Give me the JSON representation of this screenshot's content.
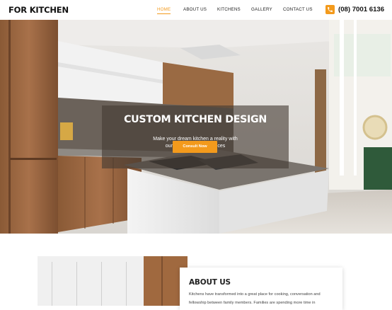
{
  "header": {
    "logo": "FOR KITCHEN",
    "nav": [
      {
        "label": "HOME",
        "active": true
      },
      {
        "label": "ABOUT US",
        "active": false
      },
      {
        "label": "KITCHENS",
        "active": false
      },
      {
        "label": "GALLERY",
        "active": false
      },
      {
        "label": "CONTACT US",
        "active": false
      }
    ],
    "phone_icon": "phone-icon",
    "phone": "(08) 7001 6136"
  },
  "hero": {
    "title": "CUSTOM KITCHEN DESIGN",
    "subtitle_line1": "Make your dream kitchen a reality with",
    "subtitle_line2": "our kitchen design services",
    "button": "Consult Now"
  },
  "about": {
    "title": "ABOUT US",
    "text_line1": "Kitchens have transformed into a great place for cooking, conversation and",
    "text_line2": "fellowship between family members. Families are spending more time in"
  },
  "colors": {
    "accent": "#f39a1c",
    "text_dark": "#111111"
  }
}
